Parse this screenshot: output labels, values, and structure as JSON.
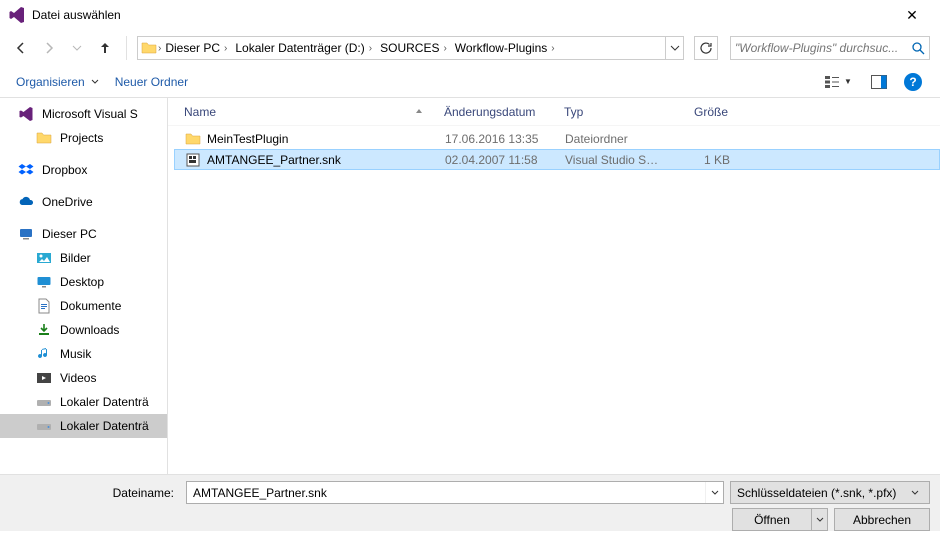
{
  "window": {
    "title": "Datei auswählen"
  },
  "nav": {
    "breadcrumb": [
      "Dieser PC",
      "Lokaler Datenträger (D:)",
      "SOURCES",
      "Workflow-Plugins"
    ],
    "search_placeholder": "\"Workflow-Plugins\" durchsuc..."
  },
  "toolbar": {
    "organize": "Organisieren",
    "new_folder": "Neuer Ordner"
  },
  "sidebar": {
    "vs": "Microsoft Visual S",
    "projects": "Projects",
    "dropbox": "Dropbox",
    "onedrive": "OneDrive",
    "dieser_pc": "Dieser PC",
    "bilder": "Bilder",
    "desktop": "Desktop",
    "dokumente": "Dokumente",
    "downloads": "Downloads",
    "musik": "Musik",
    "videos": "Videos",
    "drive1": "Lokaler Datenträ",
    "drive2": "Lokaler Datenträ"
  },
  "columns": {
    "name": "Name",
    "date": "Änderungsdatum",
    "type": "Typ",
    "size": "Größe"
  },
  "files": [
    {
      "name": "MeinTestPlugin",
      "date": "17.06.2016 13:35",
      "type": "Dateiordner",
      "size": "",
      "kind": "folder",
      "selected": false
    },
    {
      "name": "AMTANGEE_Partner.snk",
      "date": "02.04.2007 11:58",
      "type": "Visual Studio Stro...",
      "size": "1 KB",
      "kind": "snk",
      "selected": true
    }
  ],
  "bottom": {
    "filename_label": "Dateiname:",
    "filename_value": "AMTANGEE_Partner.snk",
    "filter": "Schlüsseldateien (*.snk, *.pfx)",
    "open": "Öffnen",
    "cancel": "Abbrechen"
  }
}
